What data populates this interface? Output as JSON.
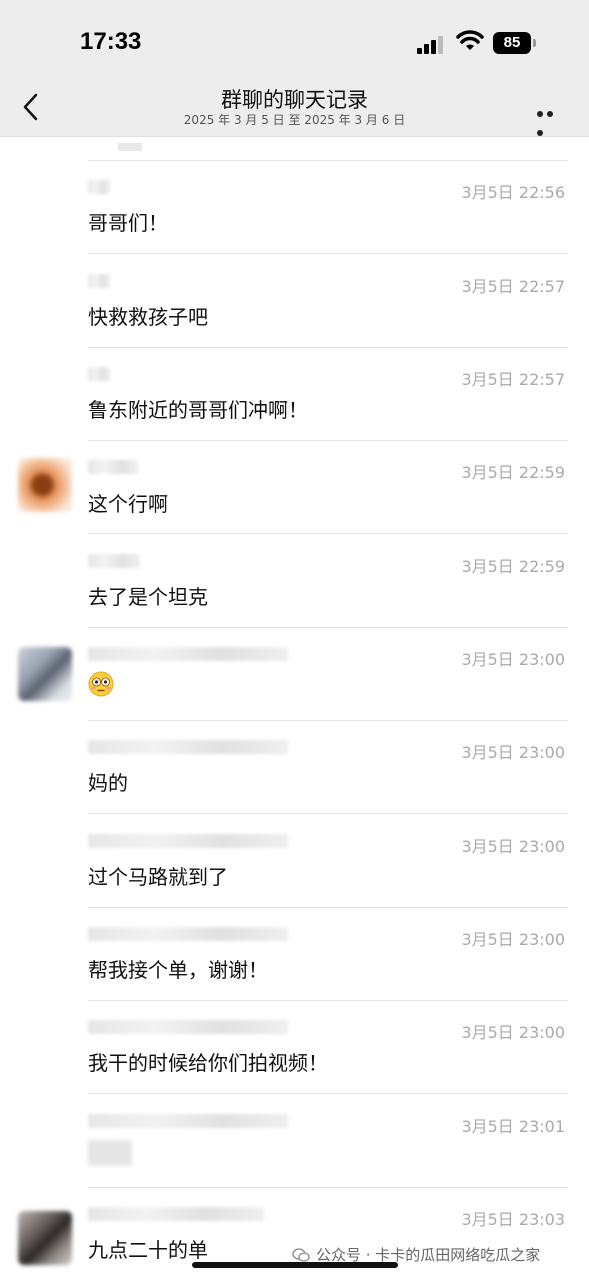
{
  "status": {
    "time": "17:33",
    "battery": "85"
  },
  "header": {
    "title": "群聊的聊天记录",
    "subtitle": "2025 年 3 月 5 日 至 2025 年 3 月 6 日"
  },
  "messages": [
    {
      "time": "3月5日 22:56",
      "text": "哥哥们！"
    },
    {
      "time": "3月5日 22:57",
      "text": "快救救孩子吧"
    },
    {
      "time": "3月5日 22:57",
      "text": "鲁东附近的哥哥们冲啊！"
    },
    {
      "time": "3月5日 22:59",
      "text": "这个行啊"
    },
    {
      "time": "3月5日 22:59",
      "text": "去了是个坦克"
    },
    {
      "time": "3月5日 23:00",
      "text": "",
      "emoji": "flushed-face"
    },
    {
      "time": "3月5日 23:00",
      "text": "妈的"
    },
    {
      "time": "3月5日 23:00",
      "text": "过个马路就到了"
    },
    {
      "time": "3月5日 23:00",
      "text": "帮我接个单，谢谢！"
    },
    {
      "time": "3月5日 23:00",
      "text": "我干的时候给你们拍视频！"
    },
    {
      "time": "3月5日 23:01",
      "text": ""
    },
    {
      "time": "3月5日 23:03",
      "text": "九点二十的单"
    }
  ],
  "watermark": "公众号 · 卡卡的瓜田网络吃瓜之家"
}
